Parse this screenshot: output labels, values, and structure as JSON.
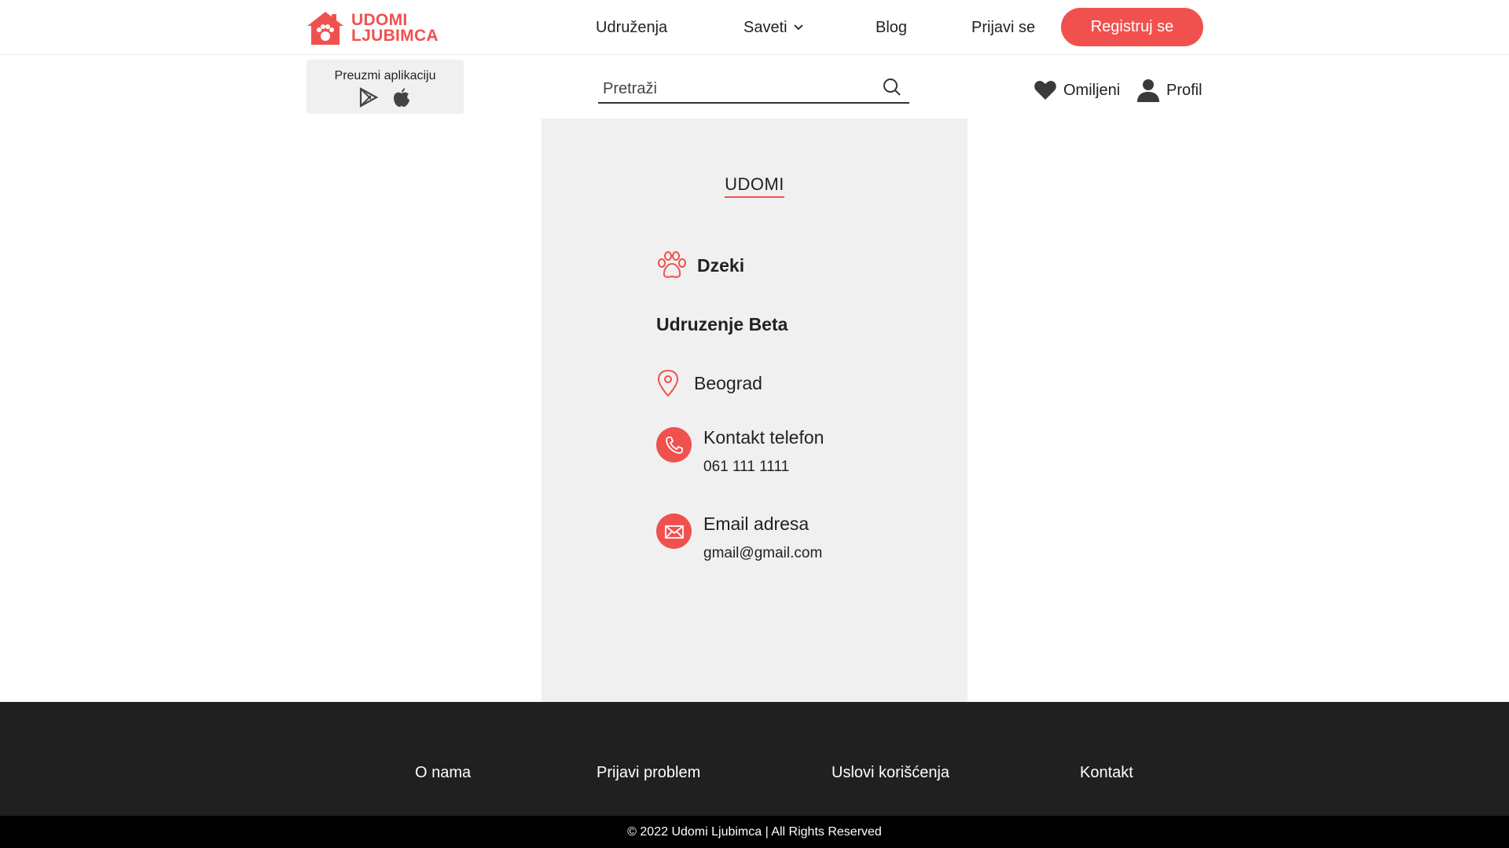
{
  "brand": {
    "line1": "UDOMI",
    "line2": "LJUBIMCA",
    "color": "#f0514f"
  },
  "nav": {
    "items": [
      {
        "label": "Udruženja"
      },
      {
        "label": "Saveti"
      },
      {
        "label": "Blog"
      },
      {
        "label": "Prijavi se"
      }
    ],
    "register_label": "Registruj se"
  },
  "app_download": {
    "label": "Preuzmi aplikaciju",
    "icons": [
      "google-play-icon",
      "apple-icon"
    ]
  },
  "search": {
    "placeholder": "Pretraži",
    "value": ""
  },
  "utility": {
    "favorites_label": "Omiljeni",
    "profile_label": "Profil"
  },
  "card": {
    "title": "UDOMI",
    "pet_name": "Dzeki",
    "association": "Udruzenje Beta",
    "city": "Beograd",
    "phone_label": "Kontakt telefon",
    "phone_value": "061 111 1111",
    "email_label": "Email adresa",
    "email_value": "gmail@gmail.com"
  },
  "footer": {
    "links": [
      {
        "label": "O nama"
      },
      {
        "label": "Prijavi problem"
      },
      {
        "label": "Uslovi korišćenja"
      },
      {
        "label": "Kontakt"
      }
    ],
    "copyright": "© 2022 Udomi Ljubimca | All Rights Reserved"
  }
}
